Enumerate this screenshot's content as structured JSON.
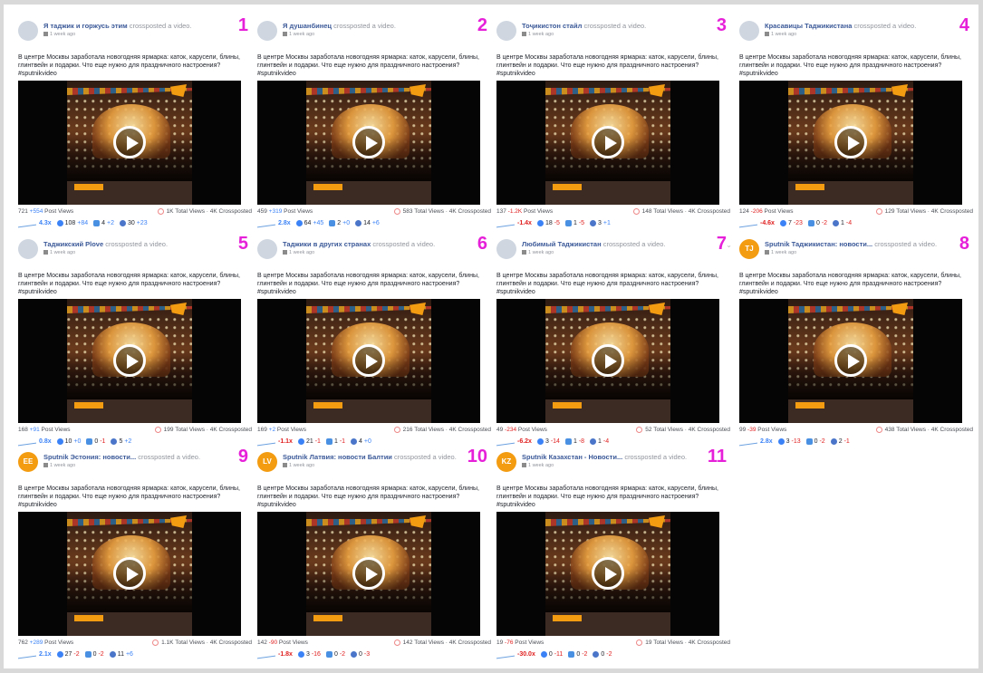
{
  "common": {
    "action": "crossposted a video.",
    "time": "1 week ago",
    "text": "В центре Москвы заработала новогодняя ярмарка: каток, карусели, блины, глинтвейн и подарки. Что еще нужно для праздничного настроения? #sputnikvideo",
    "post_views_label": "Post Views",
    "total_views_suffix": "Total Views · 4K Crossposted"
  },
  "accent_color": "#e620d8",
  "posts": [
    {
      "num": "1",
      "page": "Я таджик и горжусь этим",
      "pv": "721",
      "pv_delta": "+554",
      "pv_neg": false,
      "total": "1K",
      "mult": "4.3x",
      "mult_neg": false,
      "r": "108",
      "r_d": "+84",
      "c": "4",
      "c_d": "+2",
      "s": "30",
      "s_d": "+23"
    },
    {
      "num": "2",
      "page": "Я душанбинец",
      "pv": "459",
      "pv_delta": "+319",
      "pv_neg": false,
      "total": "583",
      "mult": "2.8x",
      "mult_neg": false,
      "r": "64",
      "r_d": "+45",
      "c": "2",
      "c_d": "+0",
      "s": "14",
      "s_d": "+6"
    },
    {
      "num": "3",
      "page": "Тоҷикистон стайл",
      "pv": "137",
      "pv_delta": "-1.2K",
      "pv_neg": true,
      "total": "148",
      "mult": "-1.4x",
      "mult_neg": true,
      "r": "18",
      "r_d": "-5",
      "c": "1",
      "c_d": "-5",
      "s": "3",
      "s_d": "+1"
    },
    {
      "num": "4",
      "page": "Красавицы Таджикистана",
      "pv": "124",
      "pv_delta": "-206",
      "pv_neg": true,
      "total": "129",
      "mult": "-4.6x",
      "mult_neg": true,
      "r": "7",
      "r_d": "-23",
      "c": "0",
      "c_d": "-2",
      "s": "1",
      "s_d": "-4"
    },
    {
      "num": "5",
      "page": "Таджикский Plove",
      "pv": "168",
      "pv_delta": "+91",
      "pv_neg": false,
      "total": "199",
      "mult": "0.8x",
      "mult_neg": false,
      "r": "10",
      "r_d": "+0",
      "c": "0",
      "c_d": "-1",
      "s": "5",
      "s_d": "+2"
    },
    {
      "num": "6",
      "page": "Таджики в других странах",
      "pv": "169",
      "pv_delta": "+2",
      "pv_neg": false,
      "total": "216",
      "mult": "-1.1x",
      "mult_neg": true,
      "r": "21",
      "r_d": "-1",
      "c": "1",
      "c_d": "-1",
      "s": "4",
      "s_d": "+0"
    },
    {
      "num": "7",
      "page": "Любимый Таджикистан",
      "pv": "49",
      "pv_delta": "-234",
      "pv_neg": true,
      "total": "52",
      "mult": "-6.2x",
      "mult_neg": true,
      "r": "3",
      "r_d": "-14",
      "c": "1",
      "c_d": "-8",
      "s": "1",
      "s_d": "-4"
    },
    {
      "num": "8",
      "page": "Sputnik Таджикистан: новости...",
      "pv": "99",
      "pv_delta": "-39",
      "pv_neg": true,
      "total": "438",
      "mult": "2.8x",
      "mult_neg": false,
      "r": "3",
      "r_d": "-13",
      "c": "0",
      "c_d": "-2",
      "s": "2",
      "s_d": "-1"
    },
    {
      "num": "9",
      "page": "Sputnik Эстония: новости...",
      "pv": "762",
      "pv_delta": "+289",
      "pv_neg": false,
      "total": "1.1K",
      "mult": "2.1x",
      "mult_neg": false,
      "r": "27",
      "r_d": "-2",
      "c": "0",
      "c_d": "-2",
      "s": "11",
      "s_d": "+6"
    },
    {
      "num": "10",
      "page": "Sputnik Латвия: новости Балтии",
      "pv": "142",
      "pv_delta": "-90",
      "pv_neg": true,
      "total": "142",
      "mult": "-1.8x",
      "mult_neg": true,
      "r": "3",
      "r_d": "-16",
      "c": "0",
      "c_d": "-2",
      "s": "0",
      "s_d": "-3"
    },
    {
      "num": "11",
      "page": "Sputnik Казахстан - Новости...",
      "pv": "19",
      "pv_delta": "-76",
      "pv_neg": true,
      "total": "19",
      "mult": "-30.0x",
      "mult_neg": true,
      "r": "0",
      "r_d": "-11",
      "c": "0",
      "c_d": "-2",
      "s": "0",
      "s_d": "-2"
    }
  ]
}
